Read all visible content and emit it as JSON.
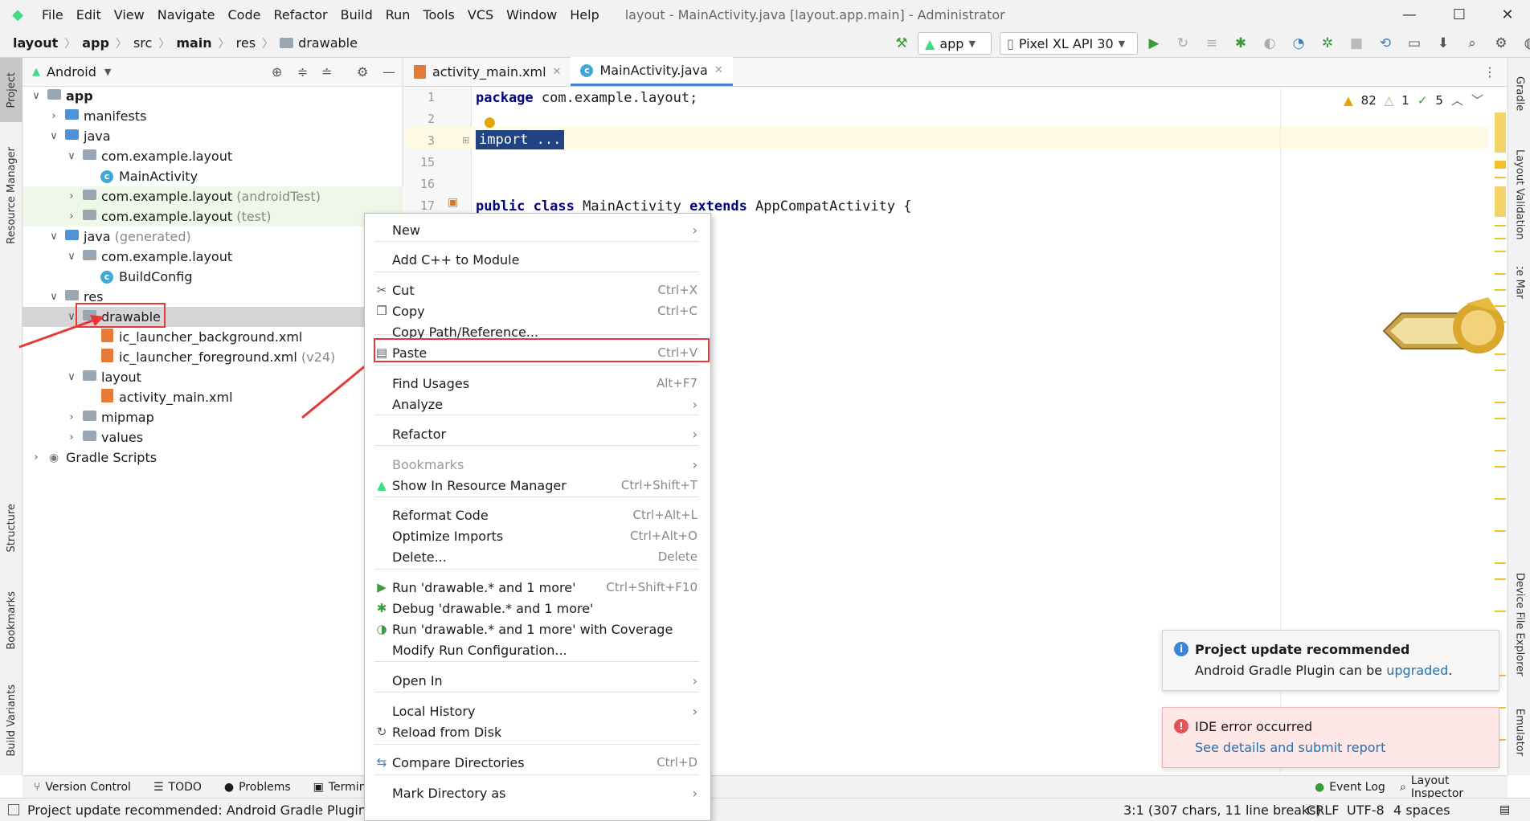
{
  "menubar": {
    "items": [
      "File",
      "Edit",
      "View",
      "Navigate",
      "Code",
      "Refactor",
      "Build",
      "Run",
      "Tools",
      "VCS",
      "Window",
      "Help"
    ],
    "window_title": "layout - MainActivity.java [layout.app.main] - Administrator"
  },
  "breadcrumbs": [
    "layout",
    "app",
    "src",
    "main",
    "res",
    "drawable"
  ],
  "toolbar": {
    "run_config": "app",
    "device": "Pixel XL API 30"
  },
  "left_tabs": [
    "Project",
    "Resource Manager",
    "Structure",
    "Bookmarks",
    "Build Variants"
  ],
  "right_tabs": [
    "Gradle",
    "Layout Validation",
    "Device Manager",
    "Device File Explorer",
    "Emulator"
  ],
  "project_panel": {
    "view_mode": "Android"
  },
  "tree": [
    {
      "label": "app",
      "suffix": ""
    },
    {
      "label": "manifests",
      "suffix": ""
    },
    {
      "label": "java",
      "suffix": ""
    },
    {
      "label": "com.example.layout",
      "suffix": ""
    },
    {
      "label": "MainActivity",
      "suffix": ""
    },
    {
      "label": "com.example.layout",
      "suffix": "(androidTest)"
    },
    {
      "label": "com.example.layout",
      "suffix": "(test)"
    },
    {
      "label": "java",
      "suffix": "(generated)"
    },
    {
      "label": "com.example.layout",
      "suffix": ""
    },
    {
      "label": "BuildConfig",
      "suffix": ""
    },
    {
      "label": "res",
      "suffix": ""
    },
    {
      "label": "drawable",
      "suffix": ""
    },
    {
      "label": "ic_launcher_background.xml",
      "suffix": ""
    },
    {
      "label": "ic_launcher_foreground.xml",
      "suffix": "(v24)"
    },
    {
      "label": "layout",
      "suffix": ""
    },
    {
      "label": "activity_main.xml",
      "suffix": ""
    },
    {
      "label": "mipmap",
      "suffix": ""
    },
    {
      "label": "values",
      "suffix": ""
    },
    {
      "label": "Gradle Scripts",
      "suffix": ""
    }
  ],
  "editor_tabs": [
    "activity_main.xml",
    "MainActivity.java"
  ],
  "editor": {
    "line_numbers": [
      "1",
      "2",
      "3",
      "15",
      "16",
      "17"
    ],
    "line1_kw": "package",
    "line1_rest": " com.example.layout;",
    "line3": "import ...",
    "line17_kw1": "public",
    "line17_kw2": "class",
    "line17_mid": " MainActivity ",
    "line17_kw3": "extends",
    "line17_rest": " AppCompatActivity {",
    "warnings": "82",
    "weak_warnings": "1",
    "typos": "5"
  },
  "context_menu": [
    {
      "label": "New",
      "shortcut": "",
      "submenu": true
    },
    {
      "label": "Add C++ to Module",
      "shortcut": "",
      "submenu": false
    },
    {
      "label": "Cut",
      "shortcut": "Ctrl+X",
      "submenu": false
    },
    {
      "label": "Copy",
      "shortcut": "Ctrl+C",
      "submenu": false
    },
    {
      "label": "Copy Path/Reference...",
      "shortcut": "",
      "submenu": false
    },
    {
      "label": "Paste",
      "shortcut": "Ctrl+V",
      "submenu": false
    },
    {
      "label": "Find Usages",
      "shortcut": "Alt+F7",
      "submenu": false
    },
    {
      "label": "Analyze",
      "shortcut": "",
      "submenu": true
    },
    {
      "label": "Refactor",
      "shortcut": "",
      "submenu": true
    },
    {
      "label": "Bookmarks",
      "shortcut": "",
      "submenu": true
    },
    {
      "label": "Show In Resource Manager",
      "shortcut": "Ctrl+Shift+T",
      "submenu": false
    },
    {
      "label": "Reformat Code",
      "shortcut": "Ctrl+Alt+L",
      "submenu": false
    },
    {
      "label": "Optimize Imports",
      "shortcut": "Ctrl+Alt+O",
      "submenu": false
    },
    {
      "label": "Delete...",
      "shortcut": "Delete",
      "submenu": false
    },
    {
      "label": "Run 'drawable.* and 1 more'",
      "shortcut": "Ctrl+Shift+F10",
      "submenu": false
    },
    {
      "label": "Debug 'drawable.* and 1 more'",
      "shortcut": "",
      "submenu": false
    },
    {
      "label": "Run 'drawable.* and 1 more' with Coverage",
      "shortcut": "",
      "submenu": false
    },
    {
      "label": "Modify Run Configuration...",
      "shortcut": "",
      "submenu": false
    },
    {
      "label": "Open In",
      "shortcut": "",
      "submenu": true
    },
    {
      "label": "Local History",
      "shortcut": "",
      "submenu": true
    },
    {
      "label": "Reload from Disk",
      "shortcut": "",
      "submenu": false
    },
    {
      "label": "Compare Directories",
      "shortcut": "Ctrl+D",
      "submenu": false
    },
    {
      "label": "Mark Directory as",
      "shortcut": "",
      "submenu": true
    }
  ],
  "notifications": {
    "update": {
      "title": "Project update recommended",
      "body": "Android Gradle Plugin can be ",
      "link": "upgraded",
      "end": "."
    },
    "error": {
      "title": "IDE error occurred",
      "link": "See details and submit report"
    }
  },
  "bottom_tabs": [
    "Version Control",
    "TODO",
    "Problems",
    "Terminal",
    "Event Log",
    "Layout Inspector"
  ],
  "status": {
    "message": "Project update recommended: Android Gradle Plugin can",
    "position": "3:1 (307 chars, 11 line breaks)",
    "line_sep": "CRLF",
    "encoding": "UTF-8",
    "indent": "4 spaces"
  },
  "colors": {
    "accent": "#4083c9",
    "keyword": "#000080",
    "selection": "#214283",
    "annotation_red": "#e53935"
  }
}
